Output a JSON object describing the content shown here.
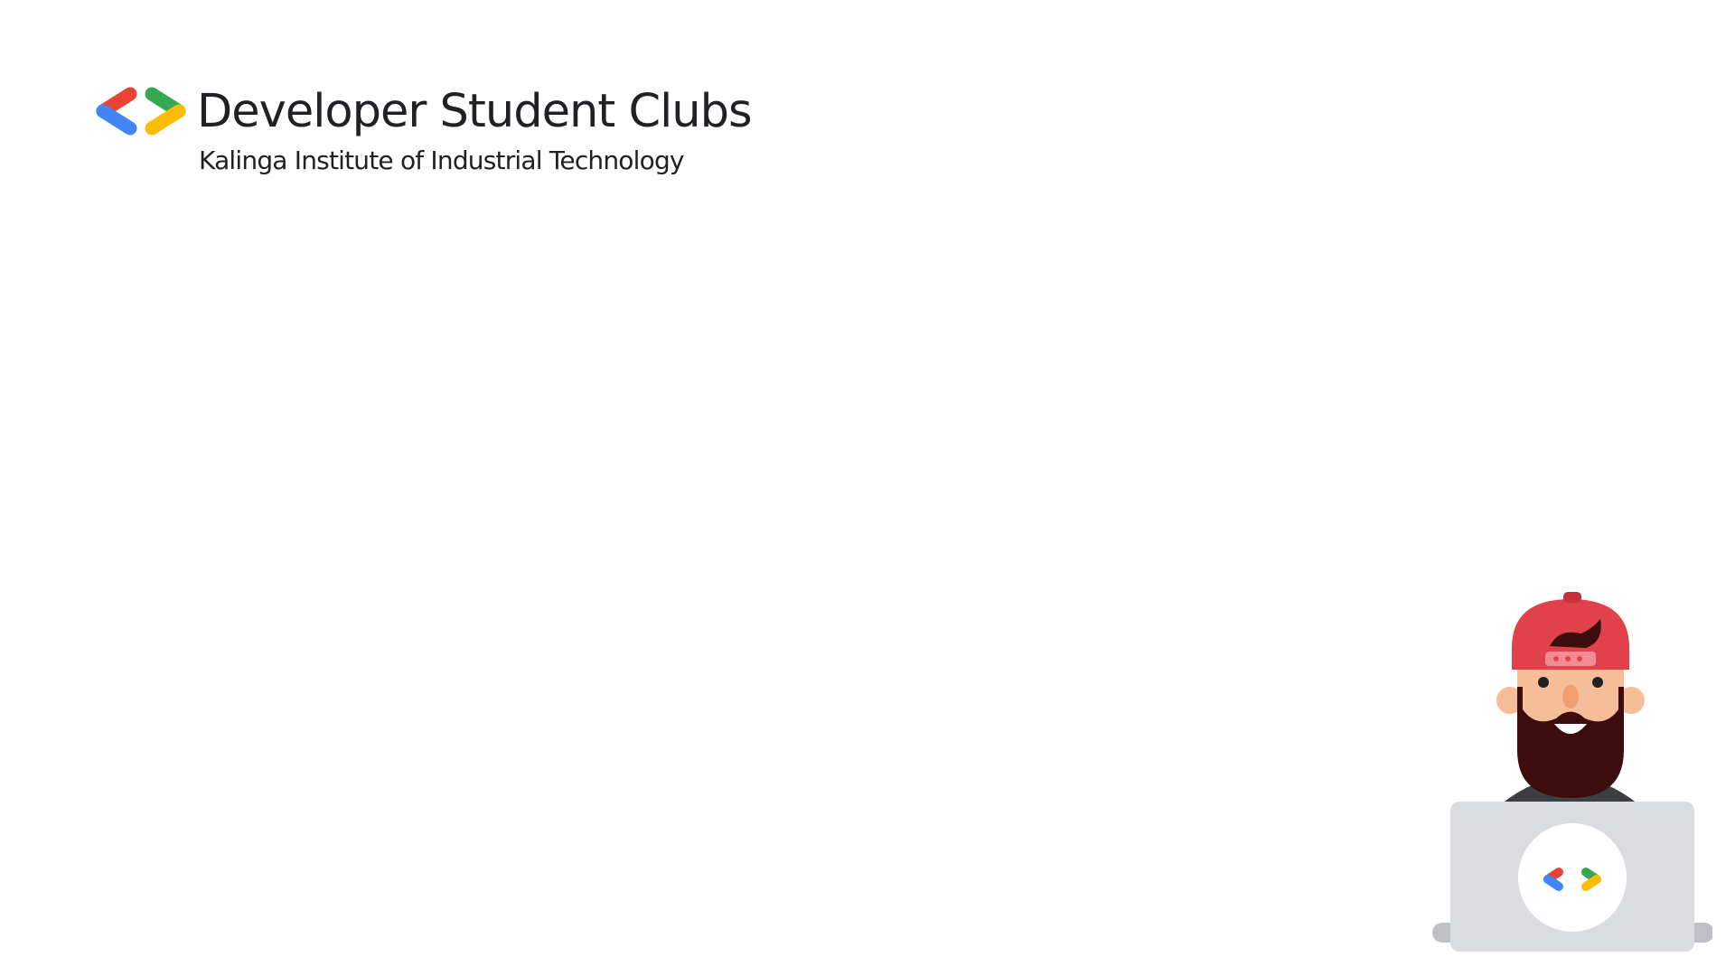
{
  "brand": {
    "title": "Developer Student Clubs",
    "subtitle": "Kalinga Institute of Industrial Technology",
    "logo_icon": "dsc-brackets-logo",
    "colors": {
      "red": "#EA4335",
      "blue": "#4285F4",
      "green": "#34A853",
      "yellow": "#FBBC04",
      "text": "#202124"
    }
  },
  "mascot": {
    "icon": "developer-with-laptop-illustration",
    "laptop_logo_icon": "dsc-brackets-logo"
  }
}
